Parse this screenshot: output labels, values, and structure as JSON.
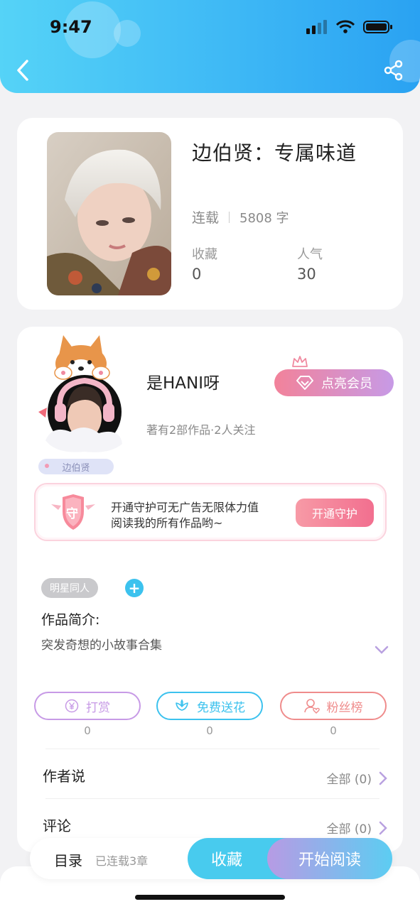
{
  "status_bar": {
    "time": "9:47"
  },
  "book": {
    "title": "边伯贤：专属味道",
    "status": "连载",
    "word_count": "5808 字",
    "favorites_label": "收藏",
    "favorites_value": "0",
    "popularity_label": "人气",
    "popularity_value": "30"
  },
  "author": {
    "name": "是HANI呀",
    "meta": "著有2部作品·2人关注",
    "avatar_caption": "边伯贤",
    "vip_button": "点亮会员"
  },
  "guard": {
    "badge": "守",
    "text_line1": "开通守护可无广告无限体力值",
    "text_line2": "阅读我的所有作品哟~",
    "button": "开通守护"
  },
  "intro": {
    "tag": "明星同人",
    "add": "+",
    "title": "作品简介:",
    "text": "突发奇想的小故事合集"
  },
  "actions": [
    {
      "label": "打赏",
      "count": "0",
      "color": "#c79ae6"
    },
    {
      "label": "免费送花",
      "count": "0",
      "color": "#3cc2ee"
    },
    {
      "label": "粉丝榜",
      "count": "0",
      "color": "#ef8c8c"
    }
  ],
  "rows": {
    "author_says_label": "作者说",
    "author_says_right": "全部 (0)",
    "comments_label": "评论",
    "comments_right": "全部 (0)"
  },
  "bottom_bar": {
    "toc_label": "目录",
    "toc_sub": "已连载3章",
    "collect_button": "收藏",
    "read_button": "开始阅读"
  },
  "colors": {
    "accent": "#3cb6f5",
    "pink": "#f26f8f",
    "purple": "#c79ae6"
  }
}
